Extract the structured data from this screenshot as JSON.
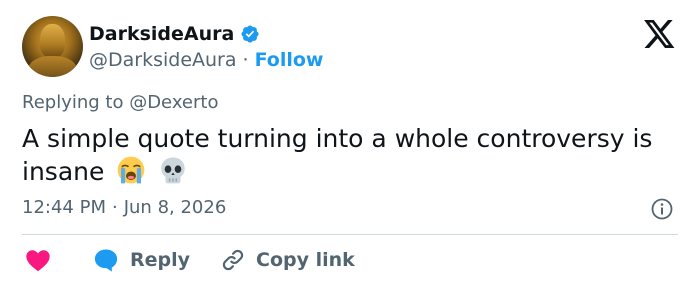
{
  "author": {
    "display_name": "DarksideAura",
    "handle": "@DarksideAura",
    "separator": "·",
    "follow_label": "Follow",
    "avatar": "golden-statue-avatar",
    "verified_icon": "verified-badge-icon"
  },
  "brand_icon": "x-logo-icon",
  "replying_to": "Replying to @Dexerto",
  "tweet": {
    "text": "A simple quote turning into a whole controversy is insane",
    "emojis": [
      "loudly-crying-face-emoji",
      "skull-emoji"
    ]
  },
  "meta": {
    "time": "12:44 PM",
    "separator": "·",
    "date": "Jun 8, 2026",
    "info_icon": "info-icon"
  },
  "actions": {
    "like_icon": "heart-icon",
    "reply_label": "Reply",
    "copy_label": "Copy link"
  },
  "colors": {
    "accent": "#1d9bf0",
    "like": "#f91880",
    "text": "#0f1419",
    "muted": "#536471",
    "divider": "#cfd9de"
  }
}
